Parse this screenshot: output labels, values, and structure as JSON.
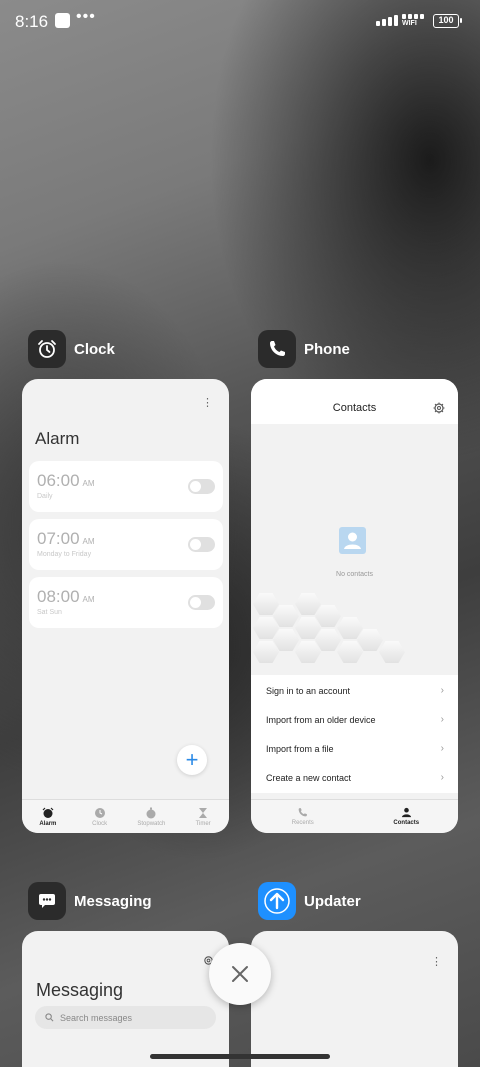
{
  "status": {
    "time": "8:16",
    "dots": "•••",
    "wifi_label": "WIFI",
    "battery": "100"
  },
  "apps": {
    "clock": {
      "name": "Clock",
      "icon": "alarm-clock-icon",
      "title": "Alarm",
      "alarms": [
        {
          "time": "06:00",
          "ampm": "AM",
          "repeat": "Daily"
        },
        {
          "time": "07:00",
          "ampm": "AM",
          "repeat": "Monday to Friday"
        },
        {
          "time": "08:00",
          "ampm": "AM",
          "repeat": "Sat Sun"
        }
      ],
      "nav": [
        "Alarm",
        "Clock",
        "Stopwatch",
        "Timer"
      ]
    },
    "phone": {
      "name": "Phone",
      "icon": "phone-icon",
      "title": "Contacts",
      "empty_text": "No contacts",
      "options": [
        "Sign in to an account",
        "Import from an older device",
        "Import from a file",
        "Create a new contact"
      ],
      "nav": [
        "Recents",
        "Contacts"
      ]
    },
    "messaging": {
      "name": "Messaging",
      "icon": "message-icon",
      "title": "Messaging",
      "search_placeholder": "Search messages"
    },
    "updater": {
      "name": "Updater",
      "icon": "update-arrow-icon",
      "accent": "#1e90ff"
    }
  },
  "colors": {
    "accent": "#2b8ae6",
    "card_bg": "#f2f2f2"
  }
}
